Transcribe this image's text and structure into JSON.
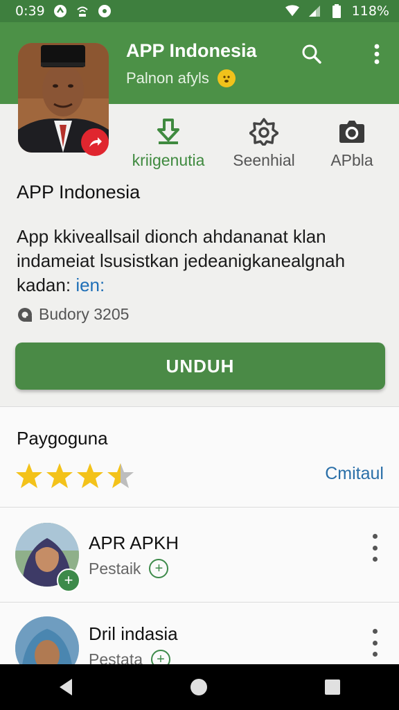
{
  "status_bar": {
    "time": "0:39",
    "battery": "118%"
  },
  "header": {
    "app_title": "APP Indonesia",
    "subtitle": "Palnon afyls",
    "icons": [
      "search-icon",
      "more-vert-icon"
    ]
  },
  "actions": [
    {
      "label": "kriigenutia",
      "icon": "download-icon",
      "active": true
    },
    {
      "label": "Seenhial",
      "icon": "gear-icon",
      "active": false
    },
    {
      "label": "APbla",
      "icon": "camera-icon",
      "active": false
    }
  ],
  "app_info": {
    "name": "APP Indonesia",
    "description": "App kkiveallsail dionch ahdananat klan indameiat lsusistkan jedeanigkanealgnah kadan:",
    "description_link": "ien:",
    "downloads": "Budory 3205"
  },
  "install_button": {
    "label": "UNDUH"
  },
  "rating": {
    "title": "Paygoguna",
    "stars": 3.5,
    "see_all": "Cmitaul"
  },
  "users": [
    {
      "name": "APR APKH",
      "sub": "Pestaik"
    },
    {
      "name": "Dril indasia",
      "sub": "Pestata"
    }
  ],
  "colors": {
    "header_green": "#4c9147",
    "status_green": "#3e7f3e",
    "button_green": "#4a8a46",
    "star_gold": "#f3c21a",
    "link_blue": "#2a6fa8"
  }
}
